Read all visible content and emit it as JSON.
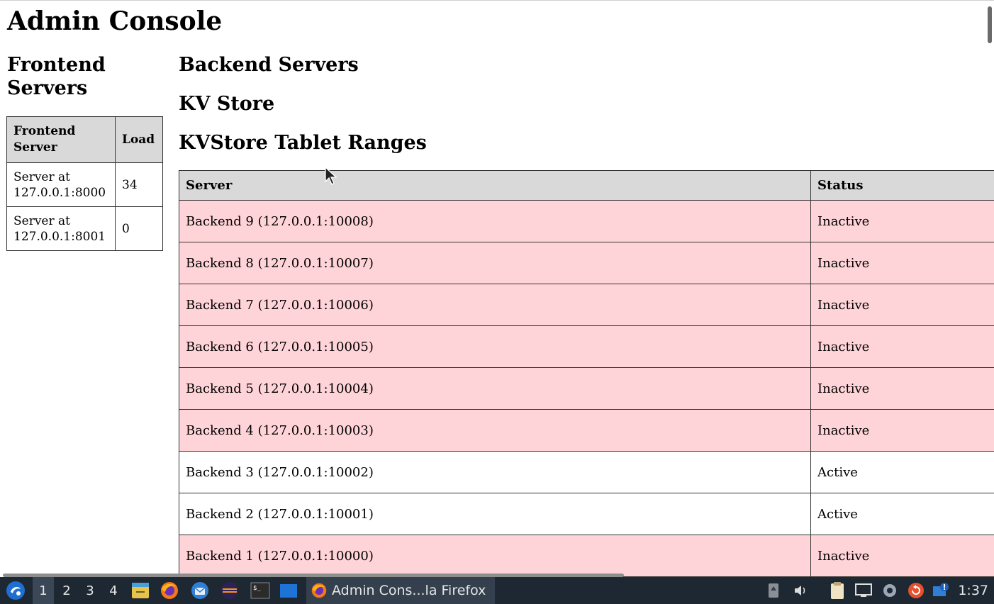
{
  "page": {
    "title": "Admin Console"
  },
  "frontend": {
    "heading": "Frontend Servers",
    "columns": [
      "Frontend Server",
      "Load"
    ],
    "rows": [
      {
        "server": "Server at 127.0.0.1:8000",
        "load": "34"
      },
      {
        "server": "Server at 127.0.0.1:8001",
        "load": "0"
      }
    ]
  },
  "sections": {
    "backend": "Backend Servers",
    "kvstore": "KV Store",
    "tablet_ranges": "KVStore Tablet Ranges"
  },
  "backend_table": {
    "columns": [
      "Server",
      "Status"
    ],
    "rows": [
      {
        "server": "Backend 9 (127.0.0.1:10008)",
        "status": "Inactive"
      },
      {
        "server": "Backend 8 (127.0.0.1:10007)",
        "status": "Inactive"
      },
      {
        "server": "Backend 7 (127.0.0.1:10006)",
        "status": "Inactive"
      },
      {
        "server": "Backend 6 (127.0.0.1:10005)",
        "status": "Inactive"
      },
      {
        "server": "Backend 5 (127.0.0.1:10004)",
        "status": "Inactive"
      },
      {
        "server": "Backend 4 (127.0.0.1:10003)",
        "status": "Inactive"
      },
      {
        "server": "Backend 3 (127.0.0.1:10002)",
        "status": "Active"
      },
      {
        "server": "Backend 2 (127.0.0.1:10001)",
        "status": "Active"
      },
      {
        "server": "Backend 1 (127.0.0.1:10000)",
        "status": "Inactive"
      }
    ]
  },
  "colors": {
    "inactive_row": "#ffd4d8",
    "active_row": "#ffffff",
    "header_bg": "#d9d9d9",
    "taskbar_bg": "#1e2833"
  },
  "taskbar": {
    "workspaces": [
      "1",
      "2",
      "3",
      "4"
    ],
    "active_workspace": "1",
    "window_title": "Admin Cons...la Firefox",
    "clock": "1:37",
    "launcher_icons": [
      "start-menu-icon",
      "file-manager-icon",
      "firefox-icon",
      "thunderbird-icon",
      "eclipse-icon",
      "terminal-icon",
      "desktop-icon"
    ],
    "tray_icons": [
      "usb-icon",
      "volume-icon",
      "clipboard-icon",
      "display-icon",
      "settings-icon",
      "update-icon",
      "notification-icon"
    ]
  }
}
